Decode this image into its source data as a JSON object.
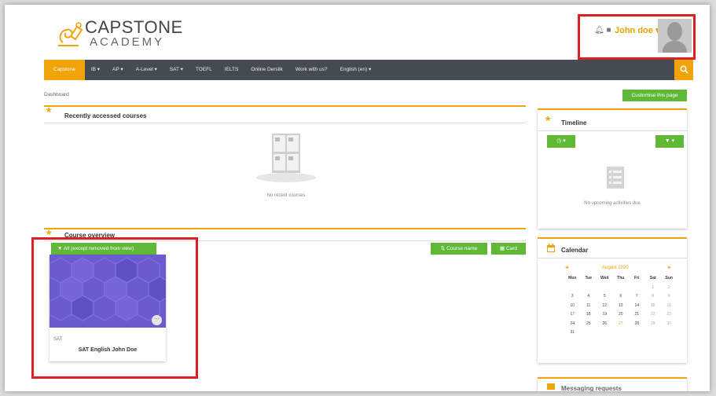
{
  "brand": {
    "title": "CAPSTONE",
    "subtitle": "ACADEMY"
  },
  "user": {
    "name": "John doe ▾",
    "icons": [
      "bell-icon",
      "chat-icon"
    ]
  },
  "nav": {
    "items": [
      {
        "label": "Capstone",
        "active": true
      },
      {
        "label": "IB ▾"
      },
      {
        "label": "AP ▾"
      },
      {
        "label": "A-Level ▾"
      },
      {
        "label": "SAT ▾"
      },
      {
        "label": "TOEFL"
      },
      {
        "label": "IELTS"
      },
      {
        "label": "Online Derslik"
      },
      {
        "label": "Work with us?"
      },
      {
        "label": "English (en) ▾"
      }
    ]
  },
  "breadcrumb": "Dashboard",
  "customise_label": "Customise this page",
  "recent": {
    "title": "Recently accessed courses",
    "empty_text": "No recent courses"
  },
  "overview": {
    "title": "Course overview",
    "filter_label": "All (except removed from view)",
    "sort_label": "Course name",
    "view_label": "Card",
    "course": {
      "category": "SAT",
      "name": "SAT English John Doe"
    }
  },
  "timeline": {
    "title": "Timeline",
    "empty_text": "No upcoming activities due"
  },
  "calendar": {
    "title": "Calendar",
    "month": "August 2020",
    "prev": "◄",
    "next": "►",
    "weekdays": [
      "Mon",
      "Tue",
      "Wed",
      "Thu",
      "Fri",
      "Sat",
      "Sun"
    ],
    "weeks": [
      [
        "",
        "",
        "",
        "",
        "",
        "1",
        "2"
      ],
      [
        "3",
        "4",
        "5",
        "6",
        "7",
        "8",
        "9"
      ],
      [
        "10",
        "11",
        "12",
        "13",
        "14",
        "15",
        "16"
      ],
      [
        "17",
        "18",
        "19",
        "20",
        "21",
        "22",
        "23"
      ],
      [
        "24",
        "25",
        "26",
        "27",
        "28",
        "29",
        "30"
      ],
      [
        "31",
        "",
        "",
        "",
        "",
        "",
        ""
      ]
    ],
    "today": "27"
  },
  "next_block_title": "Messaging requests",
  "colors": {
    "accent": "#f0a30a",
    "green": "#5fb936",
    "nav": "#444b52",
    "highlight": "#e02020"
  }
}
